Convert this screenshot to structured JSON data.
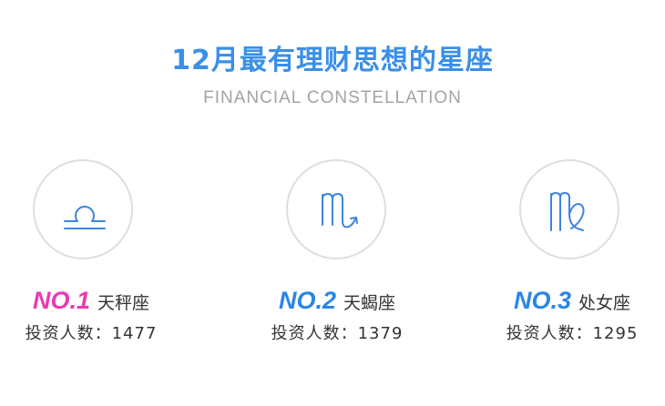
{
  "header": {
    "title": "12月最有理财思想的星座",
    "subtitle": "FINANCIAL CONSTELLATION"
  },
  "colors": {
    "title": "#3a8fe8",
    "rank_pink": "#e83ab3",
    "rank_blue": "#2a86e6",
    "circle_border": "#dcdee3",
    "icon_stroke": "#3f84e0"
  },
  "rankings": [
    {
      "rank": "NO.1",
      "sign": "天秤座",
      "icon": "libra-icon",
      "count_label": "投资人数：",
      "count": "1477"
    },
    {
      "rank": "NO.2",
      "sign": "天蝎座",
      "icon": "scorpio-icon",
      "count_label": "投资人数：",
      "count": "1379"
    },
    {
      "rank": "NO.3",
      "sign": "处女座",
      "icon": "virgo-icon",
      "count_label": "投资人数：",
      "count": "1295"
    }
  ]
}
